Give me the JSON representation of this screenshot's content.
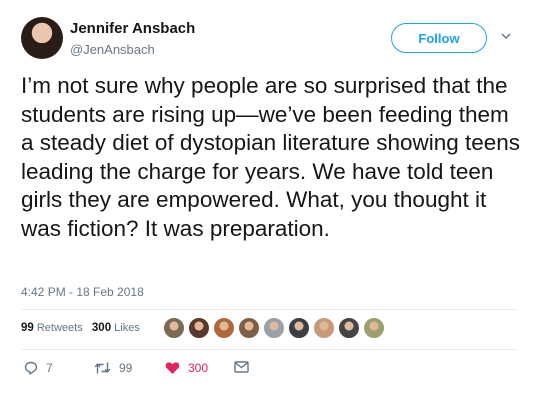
{
  "tweet": {
    "author_name": "Jennifer Ansbach",
    "author_handle": "@JenAnsbach",
    "follow_label": "Follow",
    "text": "I’m not sure why people are so surprised that the students are rising up—we’ve been feeding them a steady diet of dystopian literature showing teens leading the charge for years. We have told teen girls they are empowered. What, you thought it was fiction? It was preparation.",
    "timestamp": "4:42 PM - 18 Feb 2018",
    "retweets_count": "99",
    "retweets_label": "Retweets",
    "likes_count": "300",
    "likes_label": "Likes"
  },
  "actions": {
    "reply_count": "7",
    "retweet_count": "99",
    "like_count": "300"
  },
  "likers_avatar_colors": [
    "#7a6a55",
    "#5a3a2a",
    "#b06a3a",
    "#7d6046",
    "#98a0a8",
    "#3a3f46",
    "#c89a7a",
    "#444444",
    "#9aa070"
  ],
  "accent_color": "#1da1f2",
  "like_color": "#e0245e"
}
